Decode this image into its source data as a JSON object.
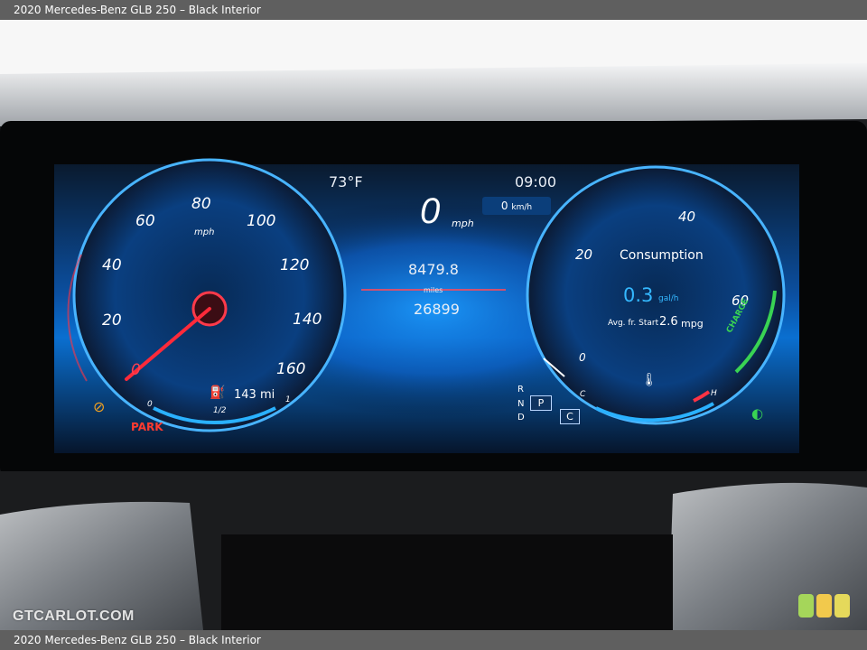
{
  "caption": "2020 Mercedes-Benz GLB 250 – Black Interior",
  "watermark": "GTCARLOT.COM",
  "cluster": {
    "temperature": "73°F",
    "clock": "09:00",
    "speed_value": "0",
    "speed_unit": "mph",
    "speed_kmh": "0",
    "speed_kmh_unit": "km/h",
    "trip": "8479.8",
    "odometer_unit": "miles",
    "odometer": "26899",
    "gears": [
      "R",
      "N",
      "D"
    ],
    "gear_active": "P",
    "drive_mode": "C",
    "park_label": "PARK"
  },
  "speedometer": {
    "unit": "mph",
    "ticks": [
      "0",
      "20",
      "40",
      "60",
      "80",
      "100",
      "120",
      "140",
      "160"
    ],
    "needle_value": 0,
    "range": "143 mi",
    "fuel_labels": [
      "0",
      "1/2",
      "1"
    ]
  },
  "power_gauge": {
    "title": "Consumption",
    "value": "0.3",
    "unit": "gal/h",
    "avg_label": "Avg. fr. Start",
    "avg_value": "2.6",
    "avg_unit": "mpg",
    "ticks": [
      "0",
      "20",
      "40",
      "60"
    ],
    "charge_label": "CHARGE",
    "temp_labels": [
      "C",
      "H"
    ]
  },
  "colors": {
    "accent_blue": "#1ea0ff",
    "needle_red": "#ff2a3a",
    "park_red": "#ff3b30",
    "charge_green": "#39d353"
  }
}
